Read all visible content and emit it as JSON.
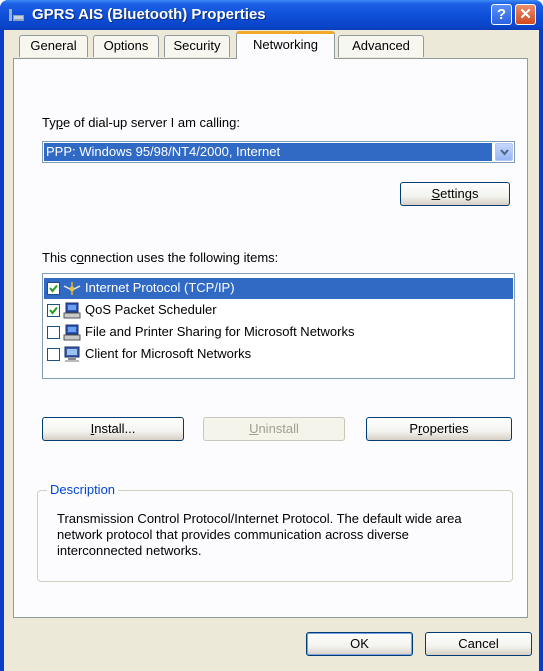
{
  "window": {
    "title": "GPRS AIS (Bluetooth) Properties",
    "help_label": "?",
    "close_label": "✕"
  },
  "tabs": [
    {
      "label": "General"
    },
    {
      "label": "Options"
    },
    {
      "label": "Security"
    },
    {
      "label": "Networking",
      "active": true
    },
    {
      "label": "Advanced"
    }
  ],
  "server_type": {
    "label_pre": "Ty",
    "label_u": "p",
    "label_post": "e of dial-up server I am calling:",
    "selected": "PPP: Windows 95/98/NT4/2000, Internet"
  },
  "buttons": {
    "settings_u": "S",
    "settings_rest": "ettings",
    "install_pre": "",
    "install_u": "I",
    "install_rest": "nstall...",
    "uninstall_u": "U",
    "uninstall_rest": "ninstall",
    "properties_pre": "P",
    "properties_u": "r",
    "properties_rest": "operties",
    "ok": "OK",
    "cancel": "Cancel"
  },
  "components": {
    "label_pre": "This c",
    "label_u": "o",
    "label_post": "nnection uses the following items:",
    "items": [
      {
        "label": "Internet Protocol (TCP/IP)",
        "checked": true,
        "selected": true,
        "icon": "protocol-icon"
      },
      {
        "label": "QoS Packet Scheduler",
        "checked": true,
        "selected": false,
        "icon": "network-service-icon"
      },
      {
        "label": "File and Printer Sharing for Microsoft Networks",
        "checked": false,
        "selected": false,
        "icon": "network-service-icon"
      },
      {
        "label": "Client for Microsoft Networks",
        "checked": false,
        "selected": false,
        "icon": "network-client-icon"
      }
    ]
  },
  "description": {
    "title": "Description",
    "text": "Transmission Control Protocol/Internet Protocol. The default wide area network protocol that provides communication across diverse interconnected networks."
  },
  "colors": {
    "title_bar": "#0f4fd9",
    "selection": "#316ac5",
    "dialog_bg": "#ece9d8",
    "tab_accent": "#f0a92a",
    "group_title": "#0046d5"
  }
}
